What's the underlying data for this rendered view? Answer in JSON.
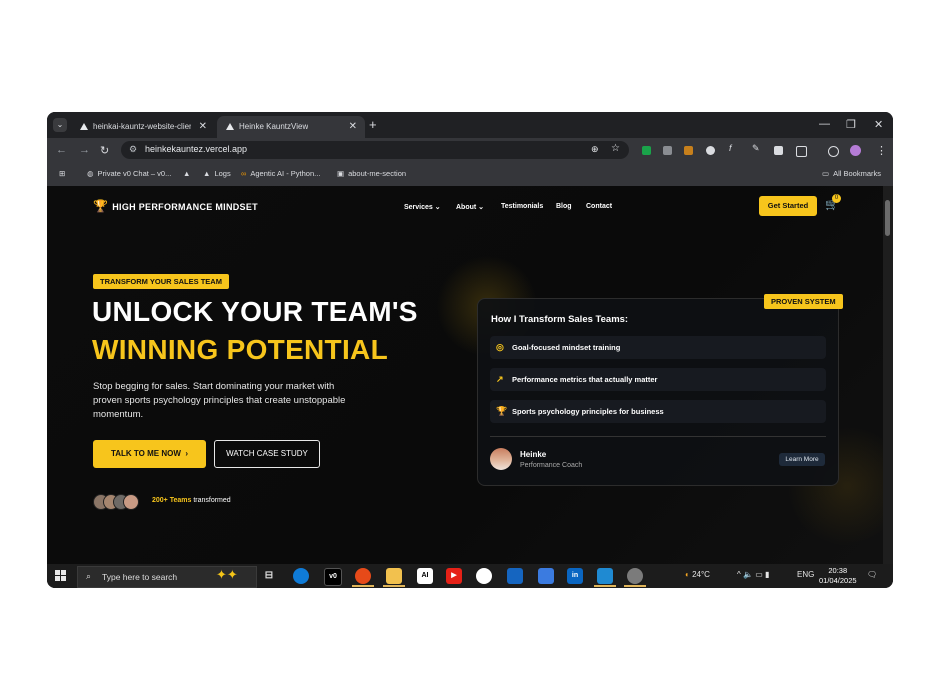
{
  "browser": {
    "tabs": [
      {
        "title": "heinkai-kauntz-website-client -"
      },
      {
        "title": "Heinke KauntzView"
      }
    ],
    "new_tab": "+",
    "url": "heinkekauntez.vercel.app",
    "bookmarks": [
      {
        "label": "Private v0 Chat – v0..."
      },
      {
        "label": ""
      },
      {
        "label": "Logs"
      },
      {
        "label": "Agentic AI - Python..."
      },
      {
        "label": "about-me-section"
      }
    ],
    "all_bookmarks": "All Bookmarks"
  },
  "site": {
    "logo": "HIGH PERFORMANCE MINDSET",
    "nav": [
      "Services",
      "About",
      "Testimonials",
      "Blog",
      "Contact"
    ],
    "get_started": "Get Started",
    "cart_count": "0",
    "badge": "TRANSFORM YOUR SALES TEAM",
    "headline_1": "UNLOCK YOUR TEAM'S",
    "headline_2": "WINNING POTENTIAL",
    "description": "Stop begging for sales. Start dominating your market with proven sports psychology principles that create unstoppable momentum.",
    "cta_primary": "TALK TO ME NOW",
    "cta_secondary": "WATCH CASE STUDY",
    "teams_count": "200+ Teams",
    "teams_suffix": "transformed"
  },
  "card": {
    "badge": "PROVEN SYSTEM",
    "title": "How I Transform Sales Teams:",
    "items": [
      {
        "label": "Goal-focused mindset training",
        "icon": "target-icon"
      },
      {
        "label": "Performance metrics that actually matter",
        "icon": "trend-icon"
      },
      {
        "label": "Sports psychology principles for business",
        "icon": "trophy-icon"
      }
    ],
    "coach_name": "Heinke",
    "coach_role": "Performance Coach",
    "learn_more": "Learn More"
  },
  "taskbar": {
    "search_placeholder": "Type here to search",
    "weather": "24°C",
    "language": "ENG",
    "time": "20:38",
    "date": "01/04/2025"
  },
  "colors": {
    "accent": "#f7c51c",
    "background": "#0b0b0b"
  }
}
